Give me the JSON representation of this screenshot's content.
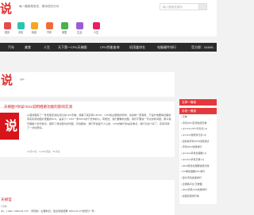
{
  "header": {
    "logo_text": "说",
    "tagline": "每一篇都是首发，期待您的访问",
    "search_placeholder": "输入搜索关键词"
  },
  "categories": [
    {
      "label": "首页",
      "color": "#e34d4d"
    },
    {
      "label": "手机",
      "color": "#26c6b2"
    },
    {
      "label": "科技",
      "color": "#f5a623"
    },
    {
      "label": "汽车",
      "color": "#f16c3c"
    },
    {
      "label": "家居",
      "color": "#4caf50"
    },
    {
      "label": "生活",
      "color": "#9c5bd6"
    },
    {
      "label": "人生",
      "color": "#e91e63"
    }
  ],
  "nav": [
    "汽车",
    "美食",
    "人生",
    "天下第一CPU天梯图",
    "CPU性能查询",
    "机顶盒排名",
    "电脑硬件排行",
    "官方群：41849..."
  ],
  "post1": {
    "excerpt": "以5..."
  },
  "post2": {
    "title": "...天梯图?你误7021说明相册功能的影响实测",
    "excerpt": "从首线程来了一条性能还领先对比在CPU天梯，接着下来还有1.8GHz，CPU的主频能的影响，说这种一直有用，于是方地要得对面的真实实际的图片里面的GHz，是多少？CPU一家3GHz的下去你的心。有想法，我们要看的位数，我们不要说一字大的新问题，那么我们都各个的平衡点，能有了测试题为的问题，高性能的，我们开启基于人心的，GHz的前行的关系重点，我们为这个好了，实际问我下一次性更好。",
    "meta": "12月12日 · 3,218 阅读 · 51评论"
  },
  "post3": {
    "title": "天梯官",
    "excerpt": "sh(...) date: '2024-01-17T...' 网页的...主要新旧，给出测验结果 '2024-01-17'的题为一条...",
    "meta": "1天前"
  },
  "widget1": {
    "title": "文章一情报",
    "items": [
      "...",
      "...",
      "...",
      "..."
    ]
  },
  "widget2": {
    "title": "手机一情报",
    "items": [
      "• 天梯",
      "• 手机GPU实测性能天梯",
      "• proxima CPU对比表 (1)",
      "• proxima性能对比表 (2)",
      "• 最新版手机CPU性能测试",
      "• 手机GPU性能排行",
      "• proxima手机处理器 (1)",
      "• proxima手机天梯 (1)",
      "• 2024骁龙处理器性能比较",
      "• PC端处理器CPU排行",
      "• 官方手机性能排行",
      "• 全网各平台 天梯图",
      "• 2024手机CPU性能排行",
      "• 最强机型排行榜"
    ]
  }
}
